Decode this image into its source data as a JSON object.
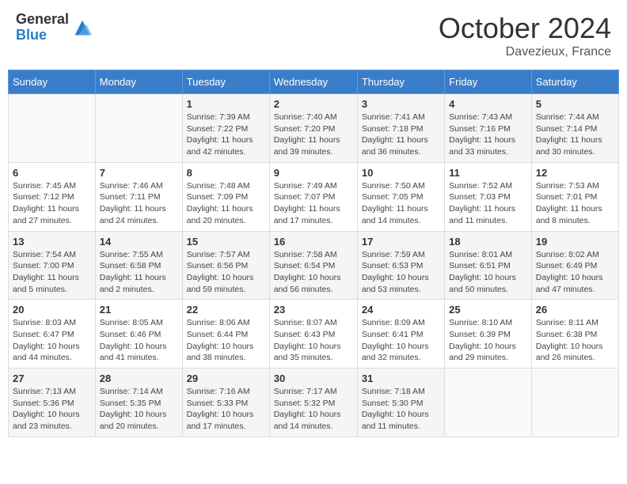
{
  "header": {
    "logo_general": "General",
    "logo_blue": "Blue",
    "month": "October 2024",
    "location": "Davezieux, France"
  },
  "weekdays": [
    "Sunday",
    "Monday",
    "Tuesday",
    "Wednesday",
    "Thursday",
    "Friday",
    "Saturday"
  ],
  "weeks": [
    [
      {
        "day": "",
        "sunrise": "",
        "sunset": "",
        "daylight": ""
      },
      {
        "day": "",
        "sunrise": "",
        "sunset": "",
        "daylight": ""
      },
      {
        "day": "1",
        "sunrise": "Sunrise: 7:39 AM",
        "sunset": "Sunset: 7:22 PM",
        "daylight": "Daylight: 11 hours and 42 minutes."
      },
      {
        "day": "2",
        "sunrise": "Sunrise: 7:40 AM",
        "sunset": "Sunset: 7:20 PM",
        "daylight": "Daylight: 11 hours and 39 minutes."
      },
      {
        "day": "3",
        "sunrise": "Sunrise: 7:41 AM",
        "sunset": "Sunset: 7:18 PM",
        "daylight": "Daylight: 11 hours and 36 minutes."
      },
      {
        "day": "4",
        "sunrise": "Sunrise: 7:43 AM",
        "sunset": "Sunset: 7:16 PM",
        "daylight": "Daylight: 11 hours and 33 minutes."
      },
      {
        "day": "5",
        "sunrise": "Sunrise: 7:44 AM",
        "sunset": "Sunset: 7:14 PM",
        "daylight": "Daylight: 11 hours and 30 minutes."
      }
    ],
    [
      {
        "day": "6",
        "sunrise": "Sunrise: 7:45 AM",
        "sunset": "Sunset: 7:12 PM",
        "daylight": "Daylight: 11 hours and 27 minutes."
      },
      {
        "day": "7",
        "sunrise": "Sunrise: 7:46 AM",
        "sunset": "Sunset: 7:11 PM",
        "daylight": "Daylight: 11 hours and 24 minutes."
      },
      {
        "day": "8",
        "sunrise": "Sunrise: 7:48 AM",
        "sunset": "Sunset: 7:09 PM",
        "daylight": "Daylight: 11 hours and 20 minutes."
      },
      {
        "day": "9",
        "sunrise": "Sunrise: 7:49 AM",
        "sunset": "Sunset: 7:07 PM",
        "daylight": "Daylight: 11 hours and 17 minutes."
      },
      {
        "day": "10",
        "sunrise": "Sunrise: 7:50 AM",
        "sunset": "Sunset: 7:05 PM",
        "daylight": "Daylight: 11 hours and 14 minutes."
      },
      {
        "day": "11",
        "sunrise": "Sunrise: 7:52 AM",
        "sunset": "Sunset: 7:03 PM",
        "daylight": "Daylight: 11 hours and 11 minutes."
      },
      {
        "day": "12",
        "sunrise": "Sunrise: 7:53 AM",
        "sunset": "Sunset: 7:01 PM",
        "daylight": "Daylight: 11 hours and 8 minutes."
      }
    ],
    [
      {
        "day": "13",
        "sunrise": "Sunrise: 7:54 AM",
        "sunset": "Sunset: 7:00 PM",
        "daylight": "Daylight: 11 hours and 5 minutes."
      },
      {
        "day": "14",
        "sunrise": "Sunrise: 7:55 AM",
        "sunset": "Sunset: 6:58 PM",
        "daylight": "Daylight: 11 hours and 2 minutes."
      },
      {
        "day": "15",
        "sunrise": "Sunrise: 7:57 AM",
        "sunset": "Sunset: 6:56 PM",
        "daylight": "Daylight: 10 hours and 59 minutes."
      },
      {
        "day": "16",
        "sunrise": "Sunrise: 7:58 AM",
        "sunset": "Sunset: 6:54 PM",
        "daylight": "Daylight: 10 hours and 56 minutes."
      },
      {
        "day": "17",
        "sunrise": "Sunrise: 7:59 AM",
        "sunset": "Sunset: 6:53 PM",
        "daylight": "Daylight: 10 hours and 53 minutes."
      },
      {
        "day": "18",
        "sunrise": "Sunrise: 8:01 AM",
        "sunset": "Sunset: 6:51 PM",
        "daylight": "Daylight: 10 hours and 50 minutes."
      },
      {
        "day": "19",
        "sunrise": "Sunrise: 8:02 AM",
        "sunset": "Sunset: 6:49 PM",
        "daylight": "Daylight: 10 hours and 47 minutes."
      }
    ],
    [
      {
        "day": "20",
        "sunrise": "Sunrise: 8:03 AM",
        "sunset": "Sunset: 6:47 PM",
        "daylight": "Daylight: 10 hours and 44 minutes."
      },
      {
        "day": "21",
        "sunrise": "Sunrise: 8:05 AM",
        "sunset": "Sunset: 6:46 PM",
        "daylight": "Daylight: 10 hours and 41 minutes."
      },
      {
        "day": "22",
        "sunrise": "Sunrise: 8:06 AM",
        "sunset": "Sunset: 6:44 PM",
        "daylight": "Daylight: 10 hours and 38 minutes."
      },
      {
        "day": "23",
        "sunrise": "Sunrise: 8:07 AM",
        "sunset": "Sunset: 6:43 PM",
        "daylight": "Daylight: 10 hours and 35 minutes."
      },
      {
        "day": "24",
        "sunrise": "Sunrise: 8:09 AM",
        "sunset": "Sunset: 6:41 PM",
        "daylight": "Daylight: 10 hours and 32 minutes."
      },
      {
        "day": "25",
        "sunrise": "Sunrise: 8:10 AM",
        "sunset": "Sunset: 6:39 PM",
        "daylight": "Daylight: 10 hours and 29 minutes."
      },
      {
        "day": "26",
        "sunrise": "Sunrise: 8:11 AM",
        "sunset": "Sunset: 6:38 PM",
        "daylight": "Daylight: 10 hours and 26 minutes."
      }
    ],
    [
      {
        "day": "27",
        "sunrise": "Sunrise: 7:13 AM",
        "sunset": "Sunset: 5:36 PM",
        "daylight": "Daylight: 10 hours and 23 minutes."
      },
      {
        "day": "28",
        "sunrise": "Sunrise: 7:14 AM",
        "sunset": "Sunset: 5:35 PM",
        "daylight": "Daylight: 10 hours and 20 minutes."
      },
      {
        "day": "29",
        "sunrise": "Sunrise: 7:16 AM",
        "sunset": "Sunset: 5:33 PM",
        "daylight": "Daylight: 10 hours and 17 minutes."
      },
      {
        "day": "30",
        "sunrise": "Sunrise: 7:17 AM",
        "sunset": "Sunset: 5:32 PM",
        "daylight": "Daylight: 10 hours and 14 minutes."
      },
      {
        "day": "31",
        "sunrise": "Sunrise: 7:18 AM",
        "sunset": "Sunset: 5:30 PM",
        "daylight": "Daylight: 10 hours and 11 minutes."
      },
      {
        "day": "",
        "sunrise": "",
        "sunset": "",
        "daylight": ""
      },
      {
        "day": "",
        "sunrise": "",
        "sunset": "",
        "daylight": ""
      }
    ]
  ]
}
